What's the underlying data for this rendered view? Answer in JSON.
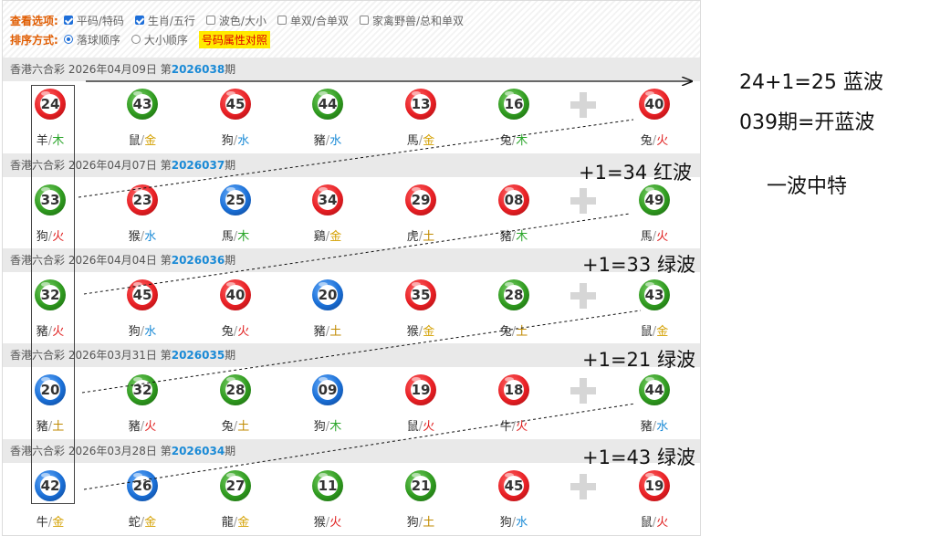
{
  "options": {
    "view_label": "查看选项:",
    "view_items": [
      {
        "label": "平码/特码",
        "checked": true
      },
      {
        "label": "生肖/五行",
        "checked": true
      },
      {
        "label": "波色/大小",
        "checked": false
      },
      {
        "label": "单双/合单双",
        "checked": false
      },
      {
        "label": "家禽野兽/总和单双",
        "checked": false
      }
    ],
    "sort_label": "排序方式:",
    "sort_items": [
      {
        "label": "落球顺序",
        "selected": true
      },
      {
        "label": "大小顺序",
        "selected": false
      }
    ],
    "highlight_button": "号码属性对照"
  },
  "draws": [
    {
      "prefix": "香港六合彩 2026年04月09日 第",
      "num": "2026038",
      "suffix": "期",
      "balls": [
        {
          "n": "24",
          "color": "red",
          "zodiac": "羊",
          "element": "木"
        },
        {
          "n": "43",
          "color": "green",
          "zodiac": "鼠",
          "element": "金"
        },
        {
          "n": "45",
          "color": "red",
          "zodiac": "狗",
          "element": "水"
        },
        {
          "n": "44",
          "color": "green",
          "zodiac": "豬",
          "element": "水"
        },
        {
          "n": "13",
          "color": "red",
          "zodiac": "馬",
          "element": "金"
        },
        {
          "n": "16",
          "color": "green",
          "zodiac": "兔",
          "element": "木"
        },
        {
          "n": "40",
          "color": "red",
          "zodiac": "兔",
          "element": "火"
        }
      ]
    },
    {
      "prefix": "香港六合彩 2026年04月07日 第",
      "num": "2026037",
      "suffix": "期",
      "balls": [
        {
          "n": "33",
          "color": "green",
          "zodiac": "狗",
          "element": "火"
        },
        {
          "n": "23",
          "color": "red",
          "zodiac": "猴",
          "element": "水"
        },
        {
          "n": "25",
          "color": "blue",
          "zodiac": "馬",
          "element": "木"
        },
        {
          "n": "34",
          "color": "red",
          "zodiac": "鷄",
          "element": "金"
        },
        {
          "n": "29",
          "color": "red",
          "zodiac": "虎",
          "element": "土"
        },
        {
          "n": "08",
          "color": "red",
          "zodiac": "豬",
          "element": "木"
        },
        {
          "n": "49",
          "color": "green",
          "zodiac": "馬",
          "element": "火"
        }
      ]
    },
    {
      "prefix": "香港六合彩 2026年04月04日 第",
      "num": "2026036",
      "suffix": "期",
      "balls": [
        {
          "n": "32",
          "color": "green",
          "zodiac": "豬",
          "element": "火"
        },
        {
          "n": "45",
          "color": "red",
          "zodiac": "狗",
          "element": "水"
        },
        {
          "n": "40",
          "color": "red",
          "zodiac": "兔",
          "element": "火"
        },
        {
          "n": "20",
          "color": "blue",
          "zodiac": "豬",
          "element": "土"
        },
        {
          "n": "35",
          "color": "red",
          "zodiac": "猴",
          "element": "金"
        },
        {
          "n": "28",
          "color": "green",
          "zodiac": "兔",
          "element": "土"
        },
        {
          "n": "43",
          "color": "green",
          "zodiac": "鼠",
          "element": "金"
        }
      ]
    },
    {
      "prefix": "香港六合彩 2026年03月31日 第",
      "num": "2026035",
      "suffix": "期",
      "balls": [
        {
          "n": "20",
          "color": "blue",
          "zodiac": "豬",
          "element": "土"
        },
        {
          "n": "32",
          "color": "green",
          "zodiac": "豬",
          "element": "火"
        },
        {
          "n": "28",
          "color": "green",
          "zodiac": "兔",
          "element": "土"
        },
        {
          "n": "09",
          "color": "blue",
          "zodiac": "狗",
          "element": "木"
        },
        {
          "n": "19",
          "color": "red",
          "zodiac": "鼠",
          "element": "火"
        },
        {
          "n": "18",
          "color": "red",
          "zodiac": "牛",
          "element": "火"
        },
        {
          "n": "44",
          "color": "green",
          "zodiac": "豬",
          "element": "水"
        }
      ]
    },
    {
      "prefix": "香港六合彩 2026年03月28日 第",
      "num": "2026034",
      "suffix": "期",
      "balls": [
        {
          "n": "42",
          "color": "blue",
          "zodiac": "牛",
          "element": "金"
        },
        {
          "n": "26",
          "color": "blue",
          "zodiac": "蛇",
          "element": "金"
        },
        {
          "n": "27",
          "color": "green",
          "zodiac": "龍",
          "element": "金"
        },
        {
          "n": "11",
          "color": "green",
          "zodiac": "猴",
          "element": "火"
        },
        {
          "n": "21",
          "color": "green",
          "zodiac": "狗",
          "element": "土"
        },
        {
          "n": "45",
          "color": "red",
          "zodiac": "狗",
          "element": "水"
        },
        {
          "n": "19",
          "color": "red",
          "zodiac": "鼠",
          "element": "火"
        }
      ]
    }
  ],
  "element_colors": {
    "金": "#d4a000",
    "木": "#2aa52a",
    "水": "#1a8ad6",
    "火": "#e02020",
    "土": "#c08a00"
  },
  "annotations": {
    "right_line1": "24+1=25 蓝波",
    "right_line2": "039期=开蓝波",
    "right_line3": "一波中特",
    "row_notes": [
      "+1=34 红波",
      "+1=33 绿波",
      "+1=21 绿波",
      "+1=43 绿波"
    ]
  }
}
